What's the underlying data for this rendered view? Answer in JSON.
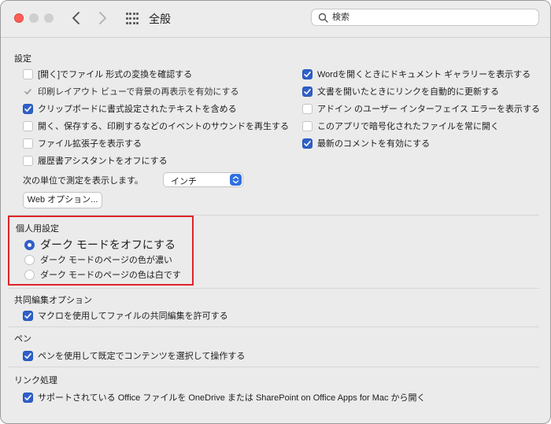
{
  "window": {
    "title": "全般",
    "search": {
      "placeholder": "検索",
      "value": ""
    }
  },
  "sections": {
    "settings": {
      "title": "設定",
      "left_options": [
        {
          "label": "[開く]でファイル 形式の変換を確認する",
          "checked": false
        },
        {
          "label": "印刷レイアウト ビューで背景の再表示を有効にする",
          "checked": true,
          "disabled": true
        },
        {
          "label": "クリップボードに書式設定されたテキストを含める",
          "checked": true
        },
        {
          "label": "開く、保存する、印刷するなどのイベントのサウンドを再生する",
          "checked": false
        },
        {
          "label": "ファイル拡張子を表示する",
          "checked": false
        },
        {
          "label": "履歴書アシスタントをオフにする",
          "checked": false
        }
      ],
      "right_options": [
        {
          "label": "Wordを開くときにドキュメント ギャラリーを表示する",
          "checked": true
        },
        {
          "label": "文書を開いたときにリンクを自動的に更新する",
          "checked": true
        },
        {
          "label": "アドイン のユーザー インターフェイス エラーを表示する",
          "checked": false
        },
        {
          "label": "このアプリで暗号化されたファイルを常に開く",
          "checked": false
        },
        {
          "label": "最新のコメントを有効にする",
          "checked": true
        }
      ],
      "measure_label": "次の単位で測定を表示します。",
      "measure_value": "インチ",
      "web_options_button": "Web オプション..."
    },
    "personal": {
      "title": "個人用設定",
      "options": [
        {
          "label": "ダーク モードをオフにする",
          "selected": true
        },
        {
          "label": "ダーク モードのページの色が濃い",
          "selected": false
        },
        {
          "label": "ダーク モードのページの色は白です",
          "selected": false
        }
      ]
    },
    "coauthoring": {
      "title": "共同編集オプション",
      "option": {
        "label": "マクロを使用してファイルの共同編集を許可する",
        "checked": true
      }
    },
    "pen": {
      "title": "ペン",
      "option": {
        "label": "ペンを使用して既定でコンテンツを選択して操作する",
        "checked": true
      }
    },
    "links": {
      "title": "リンク処理",
      "option": {
        "label": "サポートされている Office ファイルを OneDrive または SharePoint on Office Apps for Mac から開く",
        "checked": true
      }
    }
  },
  "icons": {
    "back": "chevron-left-icon",
    "forward": "chevron-right-icon",
    "grid": "show-all-grid-icon",
    "search": "search-icon"
  },
  "colors": {
    "accent": "#2f5fc8",
    "highlight_border": "#e0242a",
    "close_button": "#ff5f57"
  }
}
